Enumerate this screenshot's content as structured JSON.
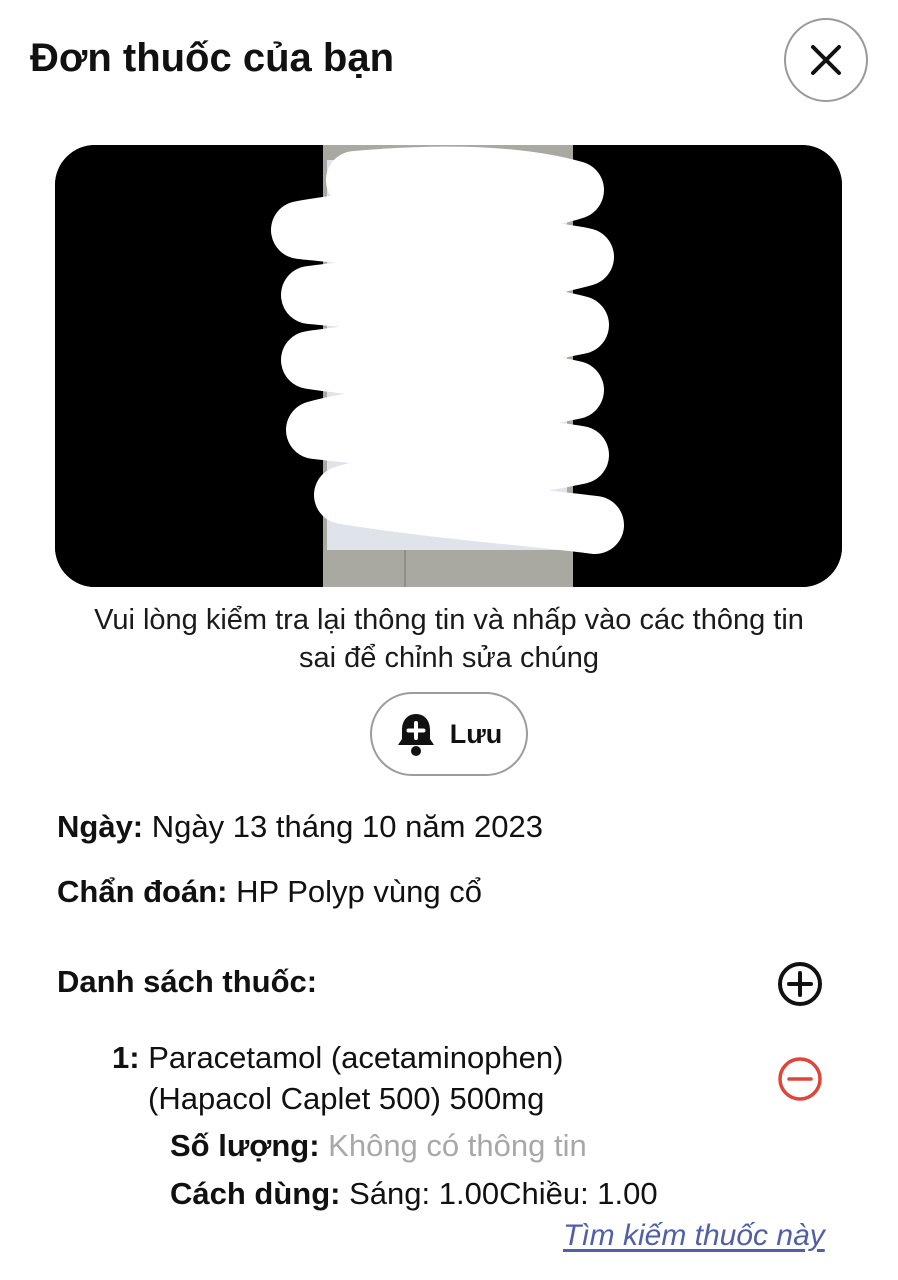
{
  "header": {
    "title": "Đơn thuốc của bạn",
    "close_icon": "close-icon"
  },
  "photo": {
    "alt_description": ""
  },
  "hint": {
    "line1": "Vui lòng kiểm tra lại thông tin và nhấp vào các thông tin",
    "line2": "sai để chỉnh sửa chúng"
  },
  "save_button": {
    "label": "Lưu",
    "icon": "bell-plus-icon"
  },
  "prescription": {
    "date_label": "Ngày:",
    "date_value": "Ngày 13 tháng 10 năm 2023",
    "diagnosis_label": "Chẩn đoán:",
    "diagnosis_value": "HP Polyp vùng cổ",
    "medicine_list_label": "Danh sách thuốc:",
    "add_icon": "plus-circle-icon",
    "medicines": [
      {
        "index": "1:",
        "name_line1": "Paracetamol (acetaminophen)",
        "name_line2": "(Hapacol Caplet 500) 500mg",
        "quantity_label": "Số lượng:",
        "quantity_value": "Không có thông tin",
        "usage_label": "Cách dùng:",
        "usage_value": "Sáng: 1.00Chiều: 1.00",
        "remove_icon": "minus-circle-icon",
        "search_link": "Tìm kiếm thuốc này"
      }
    ]
  },
  "colors": {
    "remove": "#e0453a",
    "link": "#4f5fa8",
    "muted": "#a8a8a8"
  }
}
